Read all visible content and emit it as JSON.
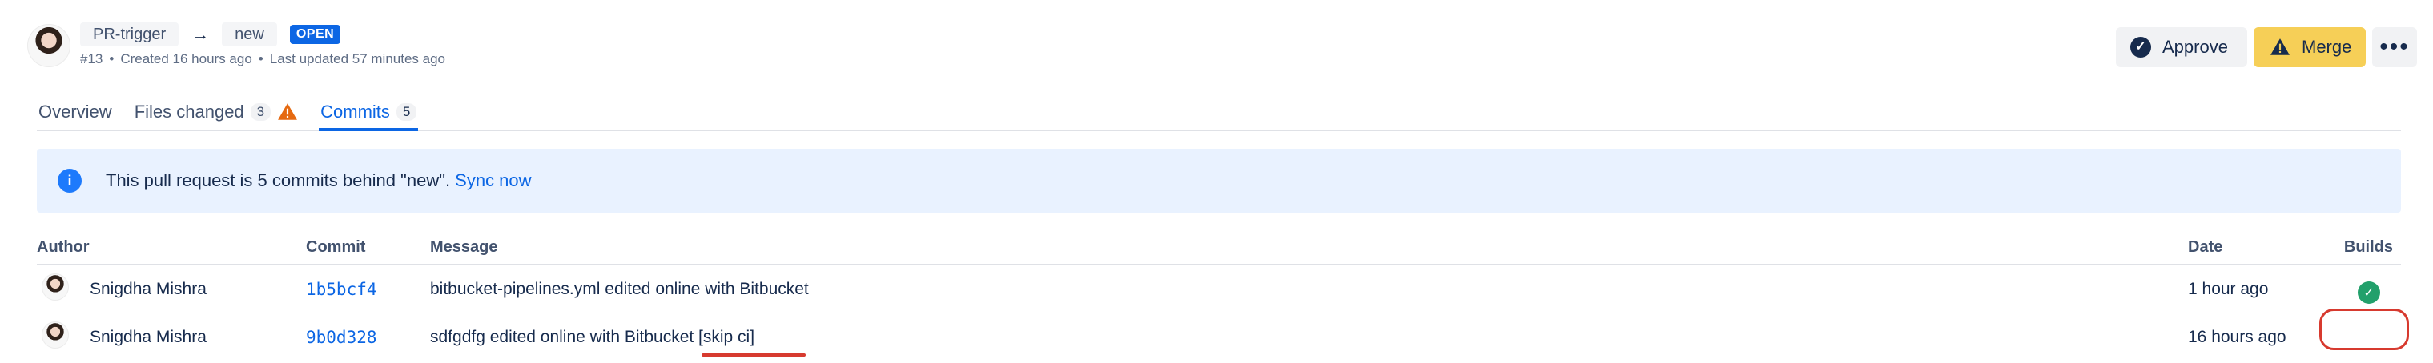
{
  "header": {
    "source_branch": "PR-trigger",
    "target_branch": "new",
    "status_badge": "OPEN",
    "meta": {
      "id": "#13",
      "created": "Created 16 hours ago",
      "updated": "Last updated 57 minutes ago",
      "separator": "•"
    },
    "actions": {
      "approve_label": "Approve",
      "merge_label": "Merge",
      "more_label": "•••"
    }
  },
  "tabs": [
    {
      "label": "Overview",
      "count": "",
      "active": false
    },
    {
      "label": "Files changed",
      "count": "3",
      "active": false,
      "warning": true
    },
    {
      "label": "Commits",
      "count": "5",
      "active": true
    }
  ],
  "banner": {
    "text": "This pull request is 5 commits behind \"new\".",
    "link": "Sync now"
  },
  "table": {
    "headers": {
      "author": "Author",
      "commit": "Commit",
      "message": "Message",
      "date": "Date",
      "builds": "Builds"
    },
    "rows": [
      {
        "author": "Snigdha Mishra",
        "commit": "1b5bcf4",
        "message": "bitbucket-pipelines.yml edited online with Bitbucket",
        "date": "1 hour ago",
        "build_status": "success"
      },
      {
        "author": "Snigdha Mishra",
        "commit": "9b0d328",
        "message": "sdfgdfg edited online with Bitbucket [skip ci]",
        "date": "16 hours ago",
        "build_status": "none"
      }
    ]
  },
  "colors": {
    "accent": "#0c66e4",
    "merge": "#f6cf57",
    "banner_bg": "#e9f2ff",
    "success": "#22a06b",
    "annotation": "#d73a2f"
  }
}
